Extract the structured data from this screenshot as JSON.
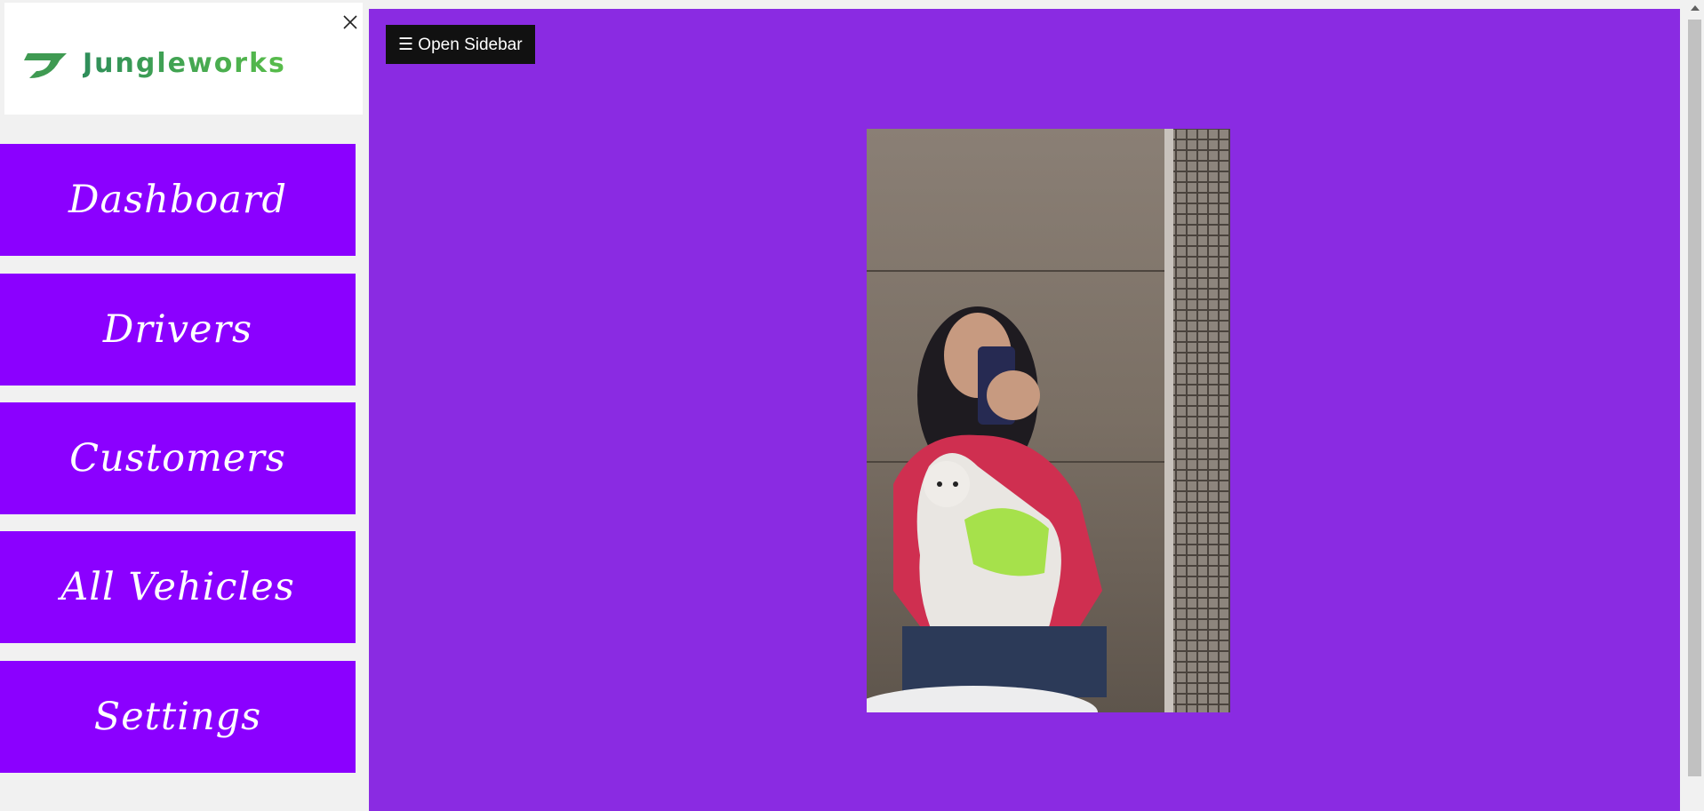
{
  "sidebar": {
    "logo_text": "Jungleworks",
    "close_icon": "close-icon",
    "items": [
      {
        "label": "Dashboard"
      },
      {
        "label": "Drivers"
      },
      {
        "label": "Customers"
      },
      {
        "label": "All Vehicles"
      },
      {
        "label": "Settings"
      }
    ]
  },
  "main": {
    "open_sidebar_label": "☰ Open Sidebar",
    "photo_icon": "photo-selfie-with-dog"
  },
  "colors": {
    "nav_purple": "#8b00ff",
    "main_purple": "#8a2be2",
    "logo_green": "#3e9a55",
    "button_black": "#111111"
  }
}
